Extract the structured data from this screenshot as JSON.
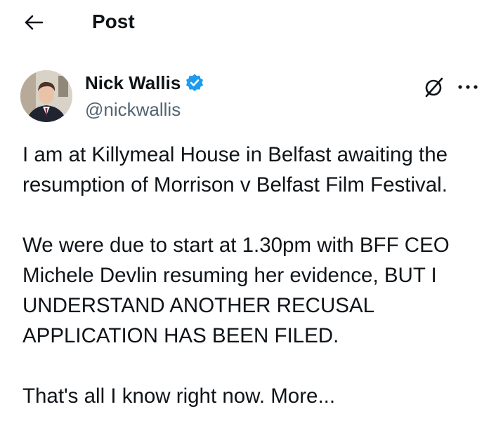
{
  "header": {
    "title": "Post",
    "back_icon": "arrow-left-icon"
  },
  "author": {
    "name": "Nick Wallis",
    "handle": "@nickwallis",
    "verified": true,
    "verified_color": "#1d9bf0"
  },
  "actions": {
    "grok_icon": "grok-slash-circle-icon",
    "more_icon": "more-horizontal-icon"
  },
  "post": {
    "paragraphs": [
      "I am at Killymeal House in Belfast awaiting the\nresumption of Morrison v Belfast Film Festival.",
      "We were due to start at 1.30pm with BFF CEO\nMichele Devlin resuming her evidence, BUT I\nUNDERSTAND ANOTHER RECUSAL\nAPPLICATION HAS BEEN FILED.",
      "That's all I know right now. More..."
    ]
  },
  "colors": {
    "text": "#0f1419",
    "secondary": "#536471",
    "accent": "#1d9bf0"
  }
}
